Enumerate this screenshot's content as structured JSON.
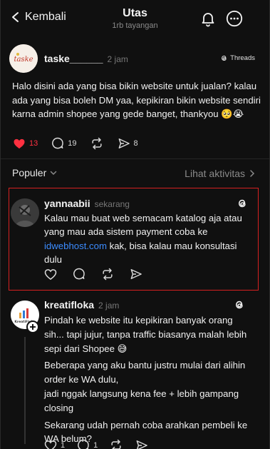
{
  "header": {
    "back_label": "Kembali",
    "title": "Utas",
    "subtitle": "1rb tayangan"
  },
  "post": {
    "avatar_text": "taske",
    "username": "taske______",
    "time": "2 jam",
    "platform_label": "Threads",
    "text": "Halo disini ada yang bisa bikin website untuk jualan? kalau ada yang bisa boleh DM yaa, kepikiran bikin website sendiri karna admin shopee yang gede banget, thankyou 🥺😭",
    "likes": "13",
    "comments": "19",
    "shares": "8",
    "like_color": "#ff3040"
  },
  "section": {
    "sort_label": "Populer",
    "activity_link": "Lihat aktivitas"
  },
  "replies": [
    {
      "username": "yannaabii",
      "time": "sekarang",
      "text_before_link": "Kalau mau buat web semacam katalog aja atau yang mau ada sistem payment coba ke ",
      "link": "idwebhost.com",
      "text_after_link": " kak, bisa kalau mau konsultasi dulu"
    },
    {
      "avatar_text": "KreatiFloka",
      "username": "kreatifloka",
      "time": "2 jam",
      "paragraphs": [
        "Pindah ke website itu kepikiran banyak orang sih... tapi jujur, tanpa traffic biasanya malah lebih sepi dari Shopee 😅",
        "Beberapa yang aku bantu justru mulai dari alihin order ke WA dulu,",
        "jadi nggak langsung kena fee + lebih gampang closing",
        "Sekarang udah pernah coba arahkan pembeli ke WA belum?"
      ],
      "likes": "1",
      "comments": "1"
    }
  ]
}
